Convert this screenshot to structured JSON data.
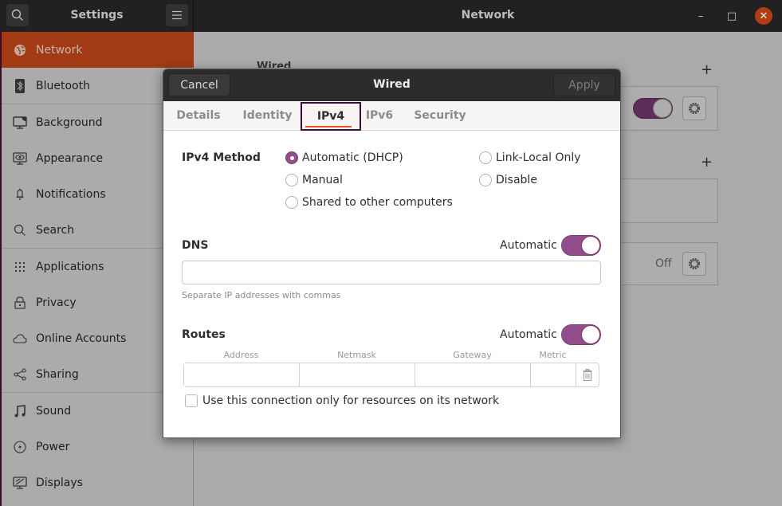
{
  "window": {
    "sidebar_title": "Settings",
    "main_title": "Network",
    "controls": {
      "minimize": "–",
      "maximize": "□",
      "close": "✕"
    }
  },
  "sidebar": {
    "items": [
      {
        "label": "Network",
        "icon": "network-icon",
        "active": true
      },
      {
        "label": "Bluetooth",
        "icon": "bluetooth-icon"
      },
      {
        "label": "Background",
        "icon": "background-icon"
      },
      {
        "label": "Appearance",
        "icon": "appearance-icon"
      },
      {
        "label": "Notifications",
        "icon": "bell-icon"
      },
      {
        "label": "Search",
        "icon": "search-icon"
      },
      {
        "label": "Applications",
        "icon": "grid-icon"
      },
      {
        "label": "Privacy",
        "icon": "lock-icon"
      },
      {
        "label": "Online Accounts",
        "icon": "cloud-icon"
      },
      {
        "label": "Sharing",
        "icon": "share-icon"
      },
      {
        "label": "Sound",
        "icon": "music-note-icon"
      },
      {
        "label": "Power",
        "icon": "power-icon"
      },
      {
        "label": "Displays",
        "icon": "display-icon"
      }
    ]
  },
  "background_panel": {
    "wired_heading": "Wired",
    "vpn_status": "Off",
    "wired_toggle_on": true
  },
  "dialog": {
    "title": "Wired",
    "cancel_label": "Cancel",
    "apply_label": "Apply",
    "tabs": [
      {
        "label": "Details"
      },
      {
        "label": "Identity"
      },
      {
        "label": "IPv4",
        "active": true
      },
      {
        "label": "IPv6"
      },
      {
        "label": "Security"
      }
    ],
    "ipv4": {
      "method_label": "IPv4 Method",
      "methods": [
        {
          "label": "Automatic (DHCP)",
          "checked": true
        },
        {
          "label": "Manual",
          "checked": false
        },
        {
          "label": "Shared to other computers",
          "checked": false
        },
        {
          "label": "Link-Local Only",
          "checked": false
        },
        {
          "label": "Disable",
          "checked": false
        }
      ],
      "dns": {
        "label": "DNS",
        "automatic_label": "Automatic",
        "automatic_on": true,
        "value": "",
        "hint": "Separate IP addresses with commas"
      },
      "routes": {
        "label": "Routes",
        "automatic_label": "Automatic",
        "automatic_on": true,
        "columns": [
          "Address",
          "Netmask",
          "Gateway",
          "Metric"
        ],
        "row": {
          "address": "",
          "netmask": "",
          "gateway": "",
          "metric": ""
        }
      },
      "only_resources_label": "Use this connection only for resources on its network",
      "only_resources_checked": false
    }
  },
  "colors": {
    "accent_orange": "#e95420",
    "accent_purple": "#924d8b",
    "active_sidebar": "#a13a15"
  }
}
